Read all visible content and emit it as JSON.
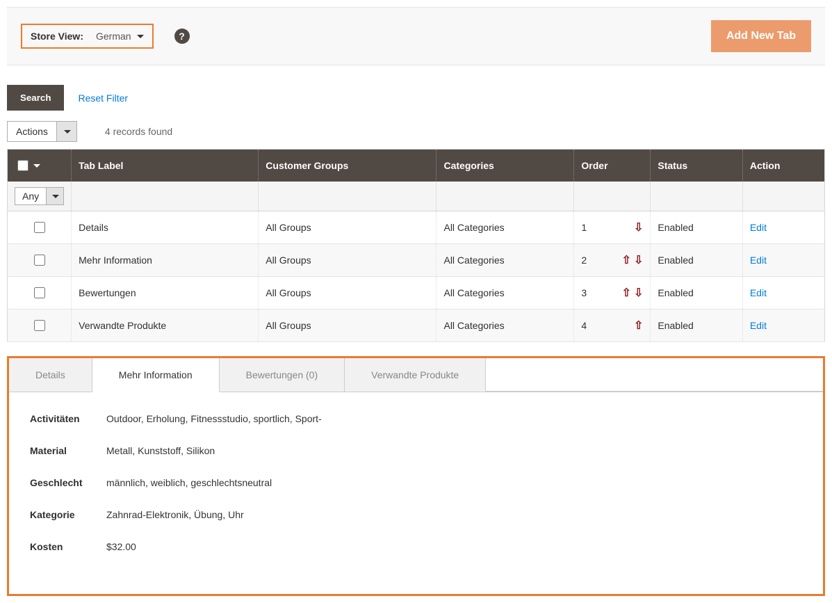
{
  "topbar": {
    "store_view_label": "Store View:",
    "store_view_value": "German",
    "add_btn": "Add New Tab"
  },
  "filters": {
    "search": "Search",
    "reset": "Reset Filter",
    "actions": "Actions",
    "records": "4 records found",
    "any": "Any"
  },
  "columns": {
    "tab_label": "Tab Label",
    "customer_groups": "Customer Groups",
    "categories": "Categories",
    "order": "Order",
    "status": "Status",
    "action": "Action"
  },
  "edit_label": "Edit",
  "rows": [
    {
      "label": "Details",
      "groups": "All Groups",
      "categories": "All Categories",
      "order": "1",
      "up": false,
      "down": true,
      "status": "Enabled"
    },
    {
      "label": "Mehr Information",
      "groups": "All Groups",
      "categories": "All Categories",
      "order": "2",
      "up": true,
      "down": true,
      "status": "Enabled"
    },
    {
      "label": "Bewertungen",
      "groups": "All Groups",
      "categories": "All Categories",
      "order": "3",
      "up": true,
      "down": true,
      "status": "Enabled"
    },
    {
      "label": "Verwandte Produkte",
      "groups": "All Groups",
      "categories": "All Categories",
      "order": "4",
      "up": true,
      "down": false,
      "status": "Enabled"
    }
  ],
  "preview": {
    "tabs": [
      "Details",
      "Mehr Information",
      "Bewertungen (0)",
      "Verwandte Produkte"
    ],
    "active_index": 1,
    "attributes": [
      {
        "label": "Activitäten",
        "value": "Outdoor, Erholung, Fitnessstudio, sportlich, Sport-"
      },
      {
        "label": "Material",
        "value": "Metall, Kunststoff, Silikon"
      },
      {
        "label": "Geschlecht",
        "value": "männlich, weiblich, geschlechtsneutral"
      },
      {
        "label": "Kategorie",
        "value": "Zahnrad-Elektronik, Übung, Uhr"
      },
      {
        "label": "Kosten",
        "value": "$32.00"
      }
    ]
  }
}
